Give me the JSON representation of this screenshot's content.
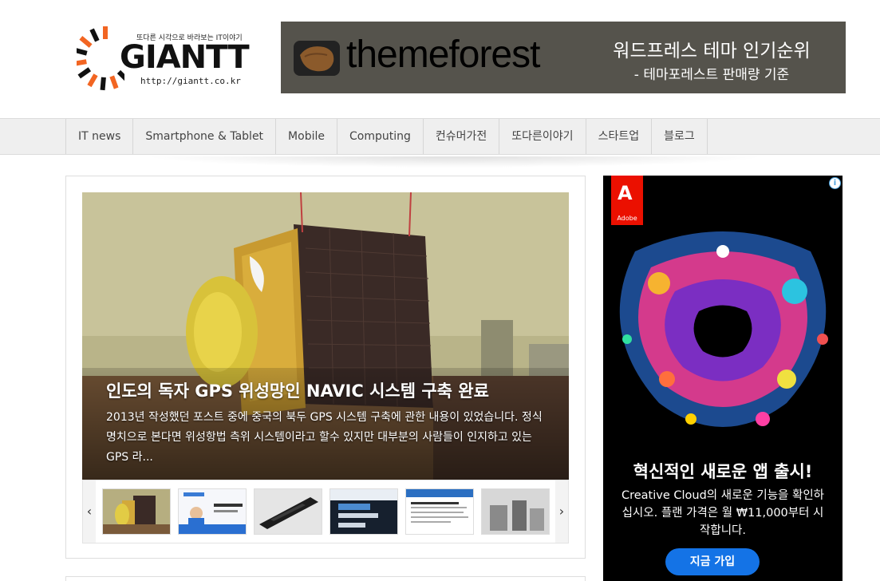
{
  "header": {
    "logo": {
      "tagline": "또다른 시각으로 바라보는 IT이야기",
      "name": "GIANTT",
      "url": "http://giantt.co.kr"
    },
    "banner": {
      "brand": "themeforest",
      "title": "워드프레스 테마 인기순위",
      "subtitle": "- 테마포레스트 판매량 기준"
    }
  },
  "nav": {
    "items": [
      "IT news",
      "Smartphone & Tablet",
      "Mobile",
      "Computing",
      "컨슈머가전",
      "또다른이야기",
      "스타트업",
      "블로그"
    ]
  },
  "slider": {
    "title": "인도의 독자 GPS 위성망인 NAVIC 시스템 구축 완료",
    "excerpt": "2013년 작성했던 포스트 중에 중국의 북두 GPS 시스템 구축에 관한 내용이 있었습니다. 정식명치으로 본다면 위성항법 측위 시스템이라고 할수 있지만 대부분의 사람들이 인지하고 있는 GPS 라...",
    "prev_icon": "‹",
    "next_icon": "›"
  },
  "ad": {
    "info_icon": "i",
    "logo_text": "Adobe",
    "headline": "혁신적인 새로운 앱 출시!",
    "body": "Creative Cloud의 새로운 기능을 확인하십시오. 플랜 가격은 월 ₩11,000부터 시작합니다.",
    "cta": "지금 가입"
  },
  "colors": {
    "nav_bg": "#efefef",
    "banner_bg": "#55534c",
    "adobe_red": "#eb1000",
    "cta_blue": "#1473e6",
    "logo_orange": "#f26522"
  }
}
